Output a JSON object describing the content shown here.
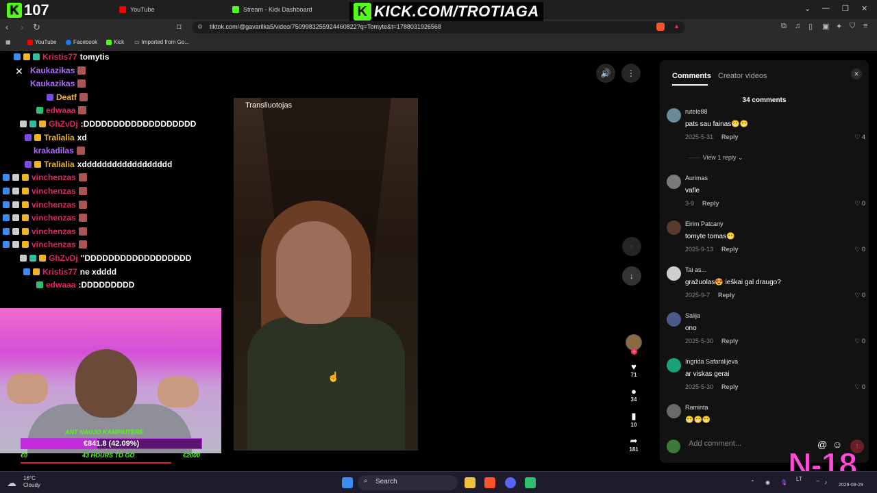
{
  "browser": {
    "tabs": [
      {
        "label": "107"
      },
      {
        "label": "YouTube"
      },
      {
        "label": "Stream - Kick Dashboard"
      }
    ],
    "url": "tiktok.com/@gavarilka5/video/7509983255924460822?q=Tomyte&t=1788031926568",
    "bookmarks": [
      "YouTube",
      "Facebook",
      "Kick",
      "Imported from Go..."
    ]
  },
  "overlay": {
    "counter": "107",
    "kick_url": "KICK.COM/TROTIAGA",
    "age_badge": "N-18"
  },
  "chat": [
    {
      "user": "Kristis77",
      "msg": "tomytis",
      "color": "#e0245e"
    },
    {
      "user": "Kaukazikas",
      "msg": "",
      "color": "#b06cff"
    },
    {
      "user": "Kaukazikas",
      "msg": "",
      "color": "#b06cff"
    },
    {
      "user": "Deatf",
      "msg": "",
      "color": "#f0b429"
    },
    {
      "user": "edwaaa",
      "msg": "",
      "color": "#e0245e"
    },
    {
      "user": "GhZvDj",
      "msg": ":DDDDDDDDDDDDDDDDDDD",
      "color": "#e0245e"
    },
    {
      "user": "Tralialia",
      "msg": "xd",
      "color": "#f0b429"
    },
    {
      "user": "krakadilas",
      "msg": "",
      "color": "#b06cff"
    },
    {
      "user": "Tralialia",
      "msg": "xdddddddddddddddddd",
      "color": "#f0b429"
    },
    {
      "user": "vinchenzas",
      "msg": "",
      "color": "#e0245e"
    },
    {
      "user": "vinchenzas",
      "msg": "",
      "color": "#e0245e"
    },
    {
      "user": "vinchenzas",
      "msg": "",
      "color": "#e0245e"
    },
    {
      "user": "vinchenzas",
      "msg": "",
      "color": "#e0245e"
    },
    {
      "user": "vinchenzas",
      "msg": "",
      "color": "#e0245e"
    },
    {
      "user": "vinchenzas",
      "msg": "",
      "color": "#e0245e"
    },
    {
      "user": "GhZvDj",
      "msg": "\"DDDDDDDDDDDDDDDDDD",
      "color": "#e0245e"
    },
    {
      "user": "Kristis77",
      "msg": "ne xdddd",
      "color": "#e0245e"
    },
    {
      "user": "edwaaa",
      "msg": ":DDDDDDDDD",
      "color": "#e0245e"
    }
  ],
  "goal": {
    "label": "ANT NAUJO KAMPIUTERE",
    "amount": "€841.8 (42.09%)",
    "progress": 0.4209,
    "start": "€0",
    "time_left": "43 HOURS TO GO",
    "target": "€2000"
  },
  "video": {
    "host_label": "Transliuotojas",
    "likes": "71",
    "comments": "34",
    "saves": "10",
    "shares": "181"
  },
  "comments_panel": {
    "tab_comments": "Comments",
    "tab_creator": "Creator videos",
    "count": "34 comments",
    "reply_label": "Reply",
    "view_reply": "View 1 reply",
    "add_placeholder": "Add comment...",
    "items": [
      {
        "user": "rutele88",
        "text": "pats sau fainas😁😁",
        "date": "2025-5-31",
        "likes": "4",
        "av": "#6a8a9a"
      },
      {
        "user": "Aurimas",
        "text": "vafle",
        "date": "3-9",
        "likes": "0",
        "av": "#7a7a7a"
      },
      {
        "user": "Eirim Patcany",
        "text": "tomyte tomas😁",
        "date": "2025-9-13",
        "likes": "0",
        "av": "#5a3a2a"
      },
      {
        "user": "Tai as...",
        "text": "gražuolas😍 ieškai gal draugo?",
        "date": "2025-9-7",
        "likes": "0",
        "av": "#cfcfcf"
      },
      {
        "user": "Salija",
        "text": "ono",
        "date": "2025-5-30",
        "likes": "0",
        "av": "#4a5a8a"
      },
      {
        "user": "Ingrida Safaralijeva",
        "text": "ar viskas gerai",
        "date": "2025-5-30",
        "likes": "0",
        "av": "#1aa37a"
      },
      {
        "user": "Raminta",
        "text": "😁😁😁",
        "date": "",
        "likes": "",
        "av": "#6a6a6a"
      }
    ]
  },
  "taskbar": {
    "temp": "16°C",
    "weather": "Cloudy",
    "search": "Search",
    "date": "2026-08-29",
    "lang": "LT"
  }
}
